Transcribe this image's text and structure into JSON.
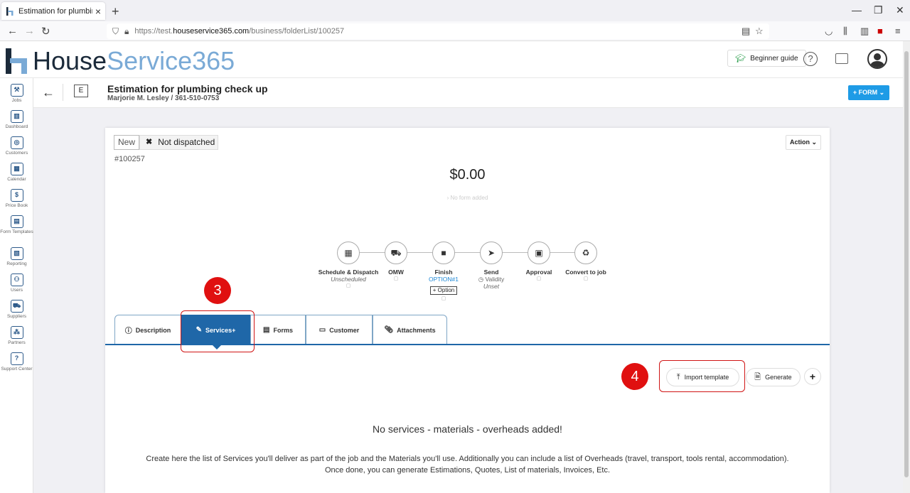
{
  "browser": {
    "tab_title": "Estimation for plumbing check up",
    "url_prefix": "https://test.",
    "url_domain": "houseservice365.com",
    "url_path": "/business/folderList/100257"
  },
  "header": {
    "logo_part1": "House",
    "logo_part2": "Service365",
    "guide_label": "Beginner guide"
  },
  "sidebar": {
    "items": [
      {
        "label": "Jobs",
        "icon": "tools-icon"
      },
      {
        "label": "Dashboard",
        "icon": "chart-icon"
      },
      {
        "label": "Customers",
        "icon": "target-icon"
      },
      {
        "label": "Calendar",
        "icon": "calendar-icon"
      },
      {
        "label": "Price Book",
        "icon": "price-tag-icon"
      },
      {
        "label": "Form Templates",
        "icon": "form-icon"
      },
      {
        "label": "Reporting",
        "icon": "report-icon"
      },
      {
        "label": "Users",
        "icon": "users-icon"
      },
      {
        "label": "Suppliers",
        "icon": "truck-icon"
      },
      {
        "label": "Partners",
        "icon": "network-icon"
      },
      {
        "label": "Support Center",
        "icon": "help-icon"
      }
    ]
  },
  "subheader": {
    "badge_letter": "E",
    "title": "Estimation for plumbing check up",
    "subtitle": "Marjorie M. Lesley / 361-510-0753",
    "form_button": "+ FORM"
  },
  "card": {
    "status_new": "New",
    "status_dispatch": "Not dispatched",
    "job_number": "#100257",
    "action_label": "Action",
    "amount": "$0.00",
    "no_form": "No form added"
  },
  "steps": [
    {
      "label": "Schedule & Dispatch",
      "sub": "Unscheduled"
    },
    {
      "label": "OMW"
    },
    {
      "label": "Finish",
      "option": "OPTION#1",
      "option_btn": "+ Option"
    },
    {
      "label": "Send",
      "validity": "Validity",
      "sub": "Unset"
    },
    {
      "label": "Approval"
    },
    {
      "label": "Convert to job"
    }
  ],
  "tabs": [
    "Description",
    "Services+",
    "Forms",
    "Customer",
    "Attachments"
  ],
  "annotations": {
    "num1": "3",
    "num2": "4"
  },
  "actions": {
    "import": "Import template",
    "generate": "Generate",
    "plus": "+"
  },
  "empty_state": {
    "title": "No services - materials - overheads added!",
    "line1": "Create here the list of Services you'll deliver as part of the job and the Materials you'll use. Additionally you can include a list of Overheads (travel, transport, tools rental, accommodation).",
    "line2": "Once done, you can generate Estimations, Quotes, List of materials, Invoices, Etc."
  },
  "colors": {
    "accent": "#1f67a8",
    "form_button": "#1e9be6",
    "annotation": "#e01010"
  }
}
